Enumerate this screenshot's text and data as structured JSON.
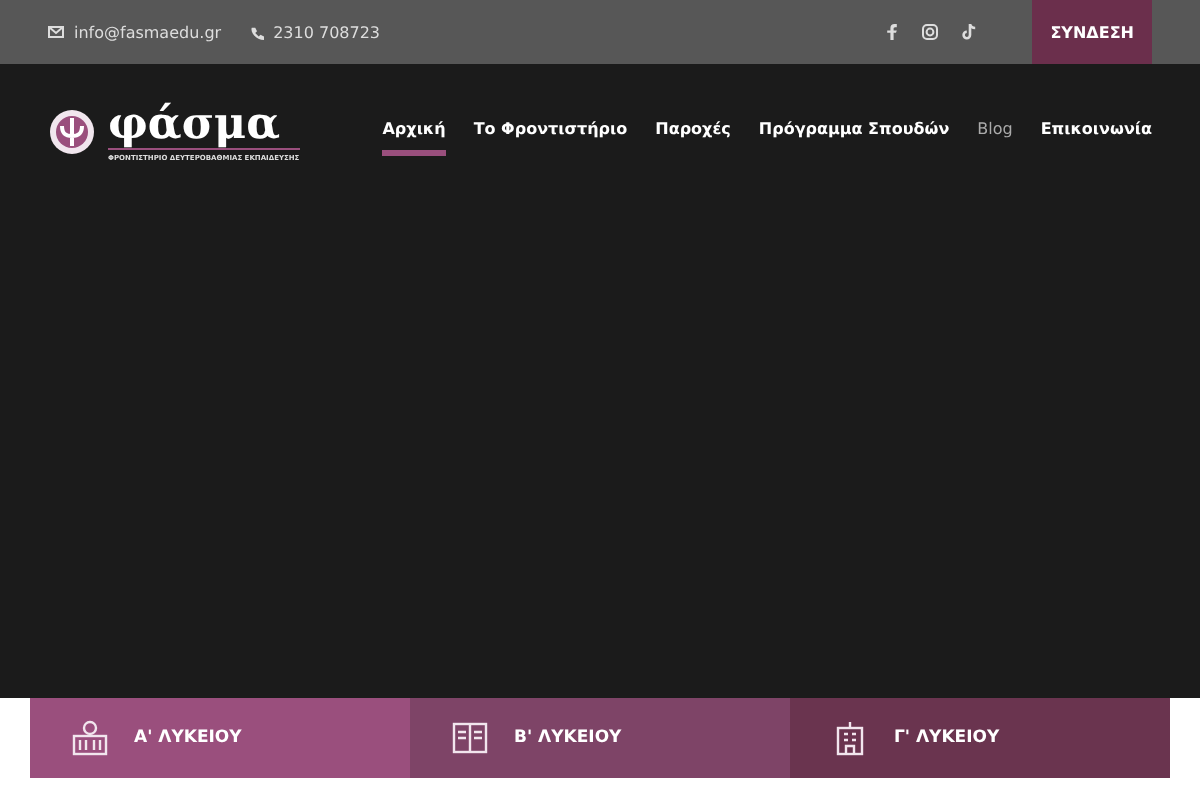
{
  "topbar": {
    "email": "info@fasmaedu.gr",
    "phone": "2310 708723",
    "login": "ΣΥΝΔΕΣΗ"
  },
  "logo": {
    "name": "φάσμα",
    "tagline": "ΦΡΟΝΤΙΣΤΗΡΙΟ ΔΕΥΤΕΡΟΒΑΘΜΙΑΣ ΕΚΠΑΙΔΕΥΣΗΣ"
  },
  "nav": [
    {
      "label": "Αρχική",
      "selected": true
    },
    {
      "label": "Το Φροντιστήριο",
      "selected": false
    },
    {
      "label": "Παροχές",
      "selected": false
    },
    {
      "label": "Πρόγραμμα Σπουδών",
      "selected": false
    },
    {
      "label": "Blog",
      "selected": false
    },
    {
      "label": "Επικοινωνία",
      "selected": false
    }
  ],
  "cards": [
    {
      "label": "Α' ΛΥΚΕΙΟΥ",
      "color": "#9a4f7d"
    },
    {
      "label": "Β' ΛΥΚΕΙΟΥ",
      "color": "#7e4467"
    },
    {
      "label": "Γ' ΛΥΚΕΙΟΥ",
      "color": "#6a344f"
    }
  ]
}
